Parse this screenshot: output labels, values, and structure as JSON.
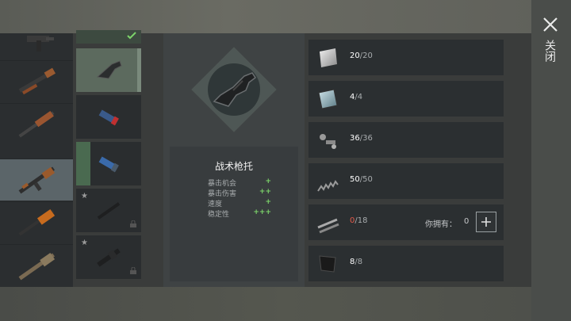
{
  "close": {
    "label": "关闭"
  },
  "part": {
    "name": "战术枪托",
    "stats": [
      {
        "label": "暴击机会",
        "value": "+"
      },
      {
        "label": "暴击伤害",
        "value": "++"
      },
      {
        "label": "速度",
        "value": "+"
      },
      {
        "label": "稳定性",
        "value": "+++"
      }
    ]
  },
  "materials": [
    {
      "have": "20",
      "need": "/20",
      "icon": "metal-plate-icon"
    },
    {
      "have": "4",
      "need": "/4",
      "icon": "glass-plate-icon"
    },
    {
      "have": "36",
      "need": "/36",
      "icon": "bolts-icon"
    },
    {
      "have": "50",
      "need": "/50",
      "icon": "spring-icon"
    },
    {
      "have": "0",
      "need": "/18",
      "icon": "rods-icon",
      "own_label": "你拥有：",
      "own_count": "0"
    },
    {
      "have": "8",
      "need": "/8",
      "icon": "rubber-icon"
    }
  ],
  "colors": {
    "accent_green": "#7cd46a",
    "shortage_red": "#e25a4a"
  }
}
